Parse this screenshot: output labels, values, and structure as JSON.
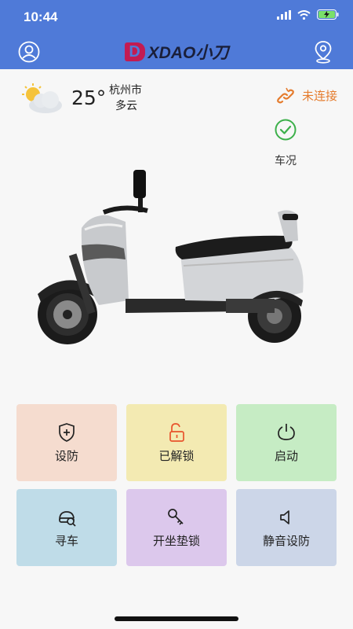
{
  "status_bar": {
    "time": "10:44"
  },
  "header": {
    "logo_mark": "D",
    "logo_text": "XDAO小刀"
  },
  "weather": {
    "temperature": "25°",
    "city": "杭州市",
    "condition": "多云"
  },
  "connection": {
    "label": "未连接",
    "color": "#e57c2e"
  },
  "vehicle_status": {
    "label": "车况",
    "color": "#3cb04a"
  },
  "controls": [
    {
      "label": "设防",
      "icon": "shield-plus-icon",
      "bg": "#f5dccf"
    },
    {
      "label": "已解锁",
      "icon": "unlocked-padlock-icon",
      "bg": "#f3eab2"
    },
    {
      "label": "启动",
      "icon": "power-icon",
      "bg": "#c6ecc4"
    },
    {
      "label": "寻车",
      "icon": "find-car-icon",
      "bg": "#bfdce8"
    },
    {
      "label": "开坐垫锁",
      "icon": "key-icon",
      "bg": "#dcc8ec"
    },
    {
      "label": "静音设防",
      "icon": "speaker-mute-icon",
      "bg": "#ccd6e8"
    }
  ],
  "colors": {
    "header": "#4f7ad8",
    "background": "#f7f7f7",
    "logo_accent": "#c21b52"
  }
}
